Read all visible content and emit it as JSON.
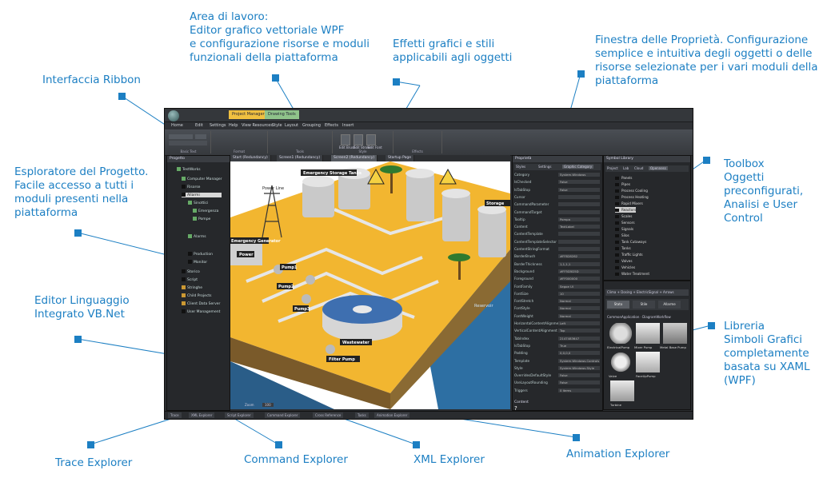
{
  "callouts": {
    "workspace": "Area di lavoro:\nEditor grafico vettoriale WPF\ne configurazione risorse e moduli\nfunzionali della piattaforma",
    "effects": "Effetti grafici e stili\napplicabili agli oggetti",
    "properties": "Finestra delle Proprietà. Configurazione\nsemplice e intuitiva degli oggetti o delle\nrisorse selezionate per i vari moduli della\npiattaforma",
    "ribbon": "Interfaccia Ribbon",
    "explorer": "Esploratore del Progetto.\nFacile accesso a tutti i\nmoduli presenti nella\npiattaforma",
    "toolbox": "Toolbox\nOggetti\npreconfigurati,\nAnalisi e User\nControl",
    "vbnet": "Editor Linguaggio\nIntegrato VB.Net",
    "library": "Libreria\nSimboli Grafici\ncompletamente\nbasata su XAML\n(WPF)",
    "trace": "Trace Explorer",
    "command": "Command Explorer",
    "xml": "XML Explorer",
    "animation": "Animation Explorer"
  },
  "app": {
    "title_tabs": [
      "Project Manager",
      "Drawing Tools"
    ],
    "menu": [
      "Home",
      "Edit",
      "Settings",
      "Help",
      "View Resources",
      "Style",
      "Layout",
      "Grouping",
      "Effects",
      "Insert"
    ],
    "ribbon_groups": [
      "Basic Text",
      "Format",
      "Tools",
      "Style",
      "Effects"
    ],
    "ribbon_buttons": [
      "Edit Brush",
      "Edit Stroke",
      "Edit Font"
    ],
    "project_panel_title": "Progetto",
    "project_tree": [
      "TestWorks",
      "Computer Manager",
      "Risorse",
      "Allarmi",
      "Sinottici",
      "Emergenza",
      "Pompe",
      "Storico",
      "Script",
      "Stringhe",
      "Child Projects",
      "Client Data Server",
      "User Management",
      "Alarms",
      "Production",
      "Monitor"
    ],
    "doc_tabs": [
      "Start (Redundancy)",
      "Screen1 (Redundancy)",
      "Screen2 (Redundancy)",
      "Startup Page"
    ],
    "properties_title": "Proprietà",
    "properties_tabs": [
      "Styles",
      "Settings",
      "Graphic Category"
    ],
    "properties": [
      {
        "k": "Category",
        "v": "System.Windows"
      },
      {
        "k": "IsChecked",
        "v": "False"
      },
      {
        "k": "IsTabStop",
        "v": "False"
      },
      {
        "k": "Cursor",
        "v": ""
      },
      {
        "k": "CommandParameter",
        "v": ""
      },
      {
        "k": "CommandTarget",
        "v": ""
      },
      {
        "k": "Tooltip",
        "v": "Pompa"
      },
      {
        "k": "Content",
        "v": "TextLabel"
      },
      {
        "k": "ContentTemplate",
        "v": ""
      },
      {
        "k": "ContentTemplateSelector",
        "v": ""
      },
      {
        "k": "ContentStringFormat",
        "v": ""
      },
      {
        "k": "BorderBrush",
        "v": "#FF828282"
      },
      {
        "k": "BorderThickness",
        "v": "1,1,1,1"
      },
      {
        "k": "Background",
        "v": "#FF5D5D5D"
      },
      {
        "k": "Foreground",
        "v": "#FF000000"
      },
      {
        "k": "FontFamily",
        "v": "Segoe UI"
      },
      {
        "k": "FontSize",
        "v": "10"
      },
      {
        "k": "FontStretch",
        "v": "Normal"
      },
      {
        "k": "FontStyle",
        "v": "Normal"
      },
      {
        "k": "FontWeight",
        "v": "Normal"
      },
      {
        "k": "HorizontalContentAlignment",
        "v": "Left"
      },
      {
        "k": "VerticalContentAlignment",
        "v": "Top"
      },
      {
        "k": "TabIndex",
        "v": "2147483647"
      },
      {
        "k": "IsTabStop",
        "v": "True"
      },
      {
        "k": "Padding",
        "v": "0,0,0,0"
      },
      {
        "k": "Template",
        "v": "System.Windows.Controls"
      },
      {
        "k": "Style",
        "v": "System.Windows.Style"
      },
      {
        "k": "OverridesDefaultStyle",
        "v": "False"
      },
      {
        "k": "UseLayoutRounding",
        "v": "False"
      },
      {
        "k": "Triggers",
        "v": "0 items"
      }
    ],
    "content_label": "Content",
    "toolbox_title": "Symbol Library",
    "toolbox_tabs": [
      "Project",
      "Lab",
      "Cloud",
      "Openness"
    ],
    "toolbox_items": [
      "Panels",
      "Pipes",
      "Process Cooling",
      "Process Heating",
      "Rapid Mixers",
      "Reactors",
      "Scales",
      "Sensors",
      "Signals",
      "Silos",
      "Tank Cutaways",
      "Tanks",
      "Traffic Lights",
      "Valves",
      "Vehicles",
      "Water Treatment"
    ],
    "symbols_path": "Clima + Dosing + ElectricSignal + Arrows",
    "symbols_tabs": [
      "Stato",
      "Stile",
      "Allarme"
    ],
    "symbols_group": "CommonApplication · DiagramWorkflow",
    "symbols": [
      "ElectricalPump",
      "Mixer Pump",
      "Metal Base Pump",
      "Valve",
      "FaceUpPump",
      "Turbine"
    ],
    "status_tabs": [
      "Trace",
      "XML Explorer",
      "Script Explorer",
      "Command Explorer",
      "Cross Reference",
      "Tasks",
      "Animation Explorer"
    ],
    "zoom_label": "Zoom",
    "zoom_value": "100"
  },
  "plant": {
    "labels": [
      "Emergency Storage Tanks",
      "Power Line",
      "Storage",
      "Emergency Generator",
      "Power",
      "Pump1",
      "Pump2",
      "Pump3",
      "Wastewater",
      "Filter Pump",
      "Reservoir"
    ]
  }
}
